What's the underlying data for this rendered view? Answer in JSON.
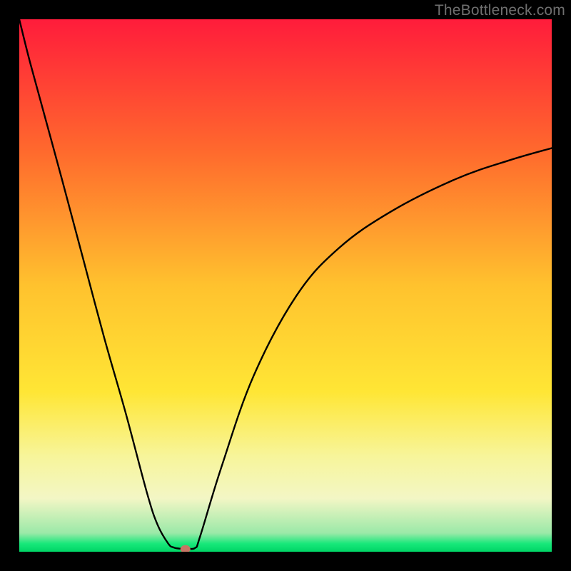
{
  "watermark": "TheBottleneck.com",
  "colors": {
    "black": "#000000",
    "red_top": "#ff1c3b",
    "orange": "#ff8a2a",
    "yellow": "#ffe635",
    "pale_yellow": "#f7f59a",
    "cream": "#f3f6c5",
    "green": "#17e87a",
    "green_bottom": "#00d566",
    "curve": "#000000",
    "marker": "#c77564"
  },
  "chart_data": {
    "type": "line",
    "title": "",
    "xlabel": "",
    "ylabel": "",
    "xlim": [
      0,
      100
    ],
    "ylim": [
      0,
      100
    ],
    "x": [
      0,
      2,
      5,
      8,
      12,
      16,
      20,
      24,
      26,
      28,
      29,
      30,
      30.5,
      31,
      33,
      34,
      38,
      44,
      52,
      60,
      70,
      82,
      92,
      100
    ],
    "y": [
      100,
      92,
      81,
      70,
      55,
      40,
      26,
      11,
      5,
      1.5,
      0.8,
      0.6,
      0.6,
      0.7,
      0.7,
      3,
      16,
      33,
      48,
      57,
      64,
      70,
      73.5,
      75.8
    ],
    "series": [
      {
        "name": "bottleneck-curve",
        "x_key": "x",
        "y_key": "y"
      }
    ],
    "marker": {
      "x": 31.2,
      "y": 0.5
    },
    "gradient_stops": [
      {
        "offset": 0.0,
        "color": "#ff1c3b"
      },
      {
        "offset": 0.25,
        "color": "#ff6a2d"
      },
      {
        "offset": 0.5,
        "color": "#ffc22e"
      },
      {
        "offset": 0.7,
        "color": "#ffe635"
      },
      {
        "offset": 0.82,
        "color": "#f7f59a"
      },
      {
        "offset": 0.9,
        "color": "#f3f6c5"
      },
      {
        "offset": 0.965,
        "color": "#9be9a8"
      },
      {
        "offset": 0.985,
        "color": "#17e87a"
      },
      {
        "offset": 1.0,
        "color": "#00d566"
      }
    ]
  }
}
